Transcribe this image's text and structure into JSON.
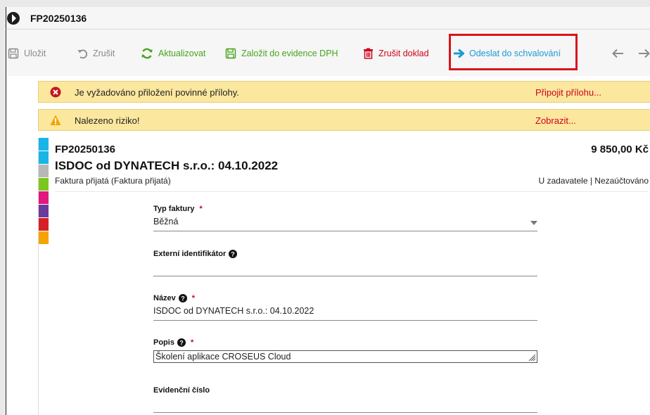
{
  "window": {
    "title": "FP20250136"
  },
  "toolbar": {
    "save_label": "Uložit",
    "cancel_label": "Zrušit",
    "refresh_label": "Aktualizovat",
    "vat_label": "Založit do evidence DPH",
    "delete_label": "Zrušit doklad",
    "send_label": "Odeslat do schvalování"
  },
  "alerts": [
    {
      "icon": "error-circle-icon",
      "text": "Je vyžadováno přiložení povinné přílohy.",
      "link": "Připojit přílohu..."
    },
    {
      "icon": "warning-triangle-icon",
      "text": "Nalezeno riziko!",
      "link": "Zobrazit..."
    }
  ],
  "document": {
    "number": "FP20250136",
    "title": "ISDOC od DYNATECH s.r.o.: 04.10.2022",
    "type": "Faktura přijatá (Faktura přijatá)",
    "amount": "9 850,00 Kč",
    "status": "U zadavatele | Nezaúčtováno",
    "strip_colors": [
      "#19b5e6",
      "#19b5e6",
      "#b8b8b8",
      "#7ac81e",
      "#e2187c",
      "#6b3a9c",
      "#d62027",
      "#f5a300"
    ]
  },
  "form": {
    "invoice_type": {
      "label": "Typ faktury",
      "required_mark": "*",
      "value": "Běžná"
    },
    "external_id": {
      "label": "Externí identifikátor",
      "value": ""
    },
    "name": {
      "label": "Název",
      "required_mark": "*",
      "value": "ISDOC od DYNATECH s.r.o.: 04.10.2022"
    },
    "description": {
      "label": "Popis",
      "required_mark": "*",
      "value": "Školení aplikace CROSEUS Cloud"
    },
    "record_number": {
      "label": "Evidenční číslo",
      "value": ""
    }
  },
  "colors": {
    "accent_blue": "#1a9ad6",
    "green": "#45a51d",
    "red": "#d0021b",
    "alert_bg": "#fbe79e",
    "highlight_border": "#d9141b"
  }
}
